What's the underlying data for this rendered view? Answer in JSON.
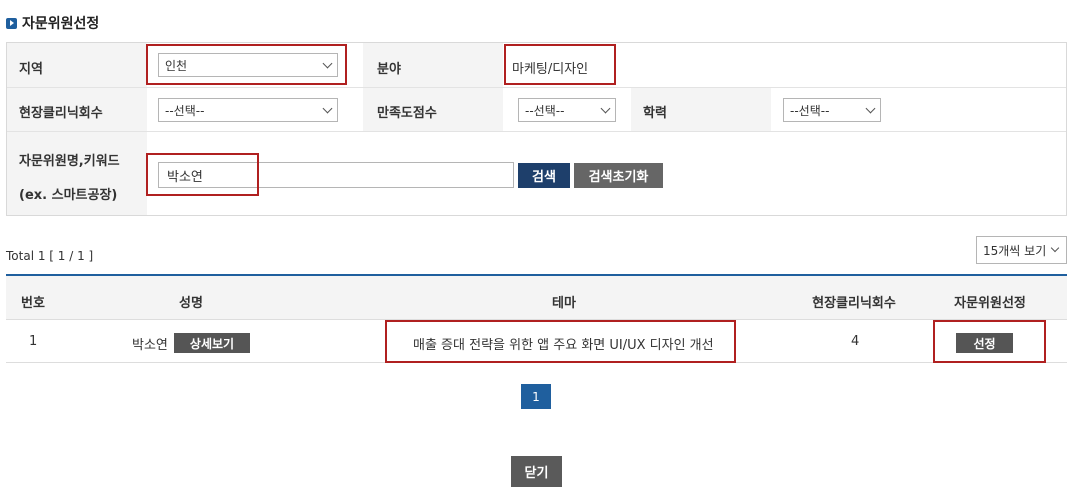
{
  "page_title": "자문위원선정",
  "form": {
    "region": {
      "label": "지역",
      "value": "인천"
    },
    "field": {
      "label": "분야",
      "value": "마케팅/디자인"
    },
    "clinic_count": {
      "label": "현장클리닉회수",
      "value": "--선택--"
    },
    "satisfaction": {
      "label": "만족도점수",
      "value": "--선택--"
    },
    "education": {
      "label": "학력",
      "value": "--선택--"
    },
    "keyword": {
      "label_line1": "자문위원명,키워드",
      "label_line2": "(ex. 스마트공장)",
      "value": "박소연"
    },
    "search_button": "검색",
    "reset_button": "검색초기화"
  },
  "results": {
    "total_text": "Total 1 [ 1 / 1 ]",
    "page_size": "15개씩 보기",
    "columns": [
      "번호",
      "성명",
      "테마",
      "현장클리닉회수",
      "자문위원선정"
    ],
    "rows": [
      {
        "number": "1",
        "name": "박소연",
        "detail_button": "상세보기",
        "theme": "매출 증대 전략을 위한 앱 주요 화면 UI/UX 디자인 개선",
        "clinic_count": "4",
        "select_button": "선정"
      }
    ]
  },
  "pagination": {
    "current": "1"
  },
  "close_button": "닫기",
  "colors": {
    "accent": "#1f5f9e",
    "highlight": "#b02020",
    "dark_button": "#555555"
  }
}
